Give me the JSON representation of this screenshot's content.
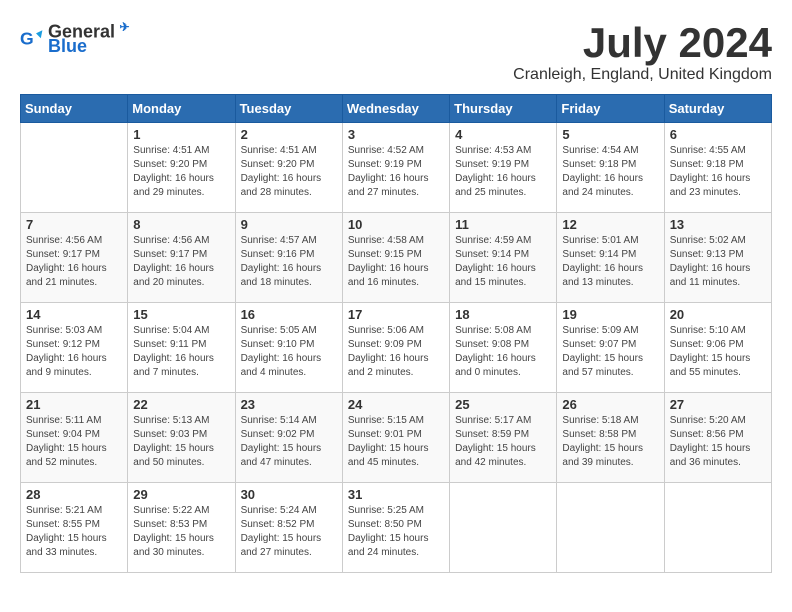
{
  "header": {
    "logo_general": "General",
    "logo_blue": "Blue",
    "month_year": "July 2024",
    "location": "Cranleigh, England, United Kingdom"
  },
  "days_of_week": [
    "Sunday",
    "Monday",
    "Tuesday",
    "Wednesday",
    "Thursday",
    "Friday",
    "Saturday"
  ],
  "weeks": [
    [
      {
        "day": "",
        "info": ""
      },
      {
        "day": "1",
        "info": "Sunrise: 4:51 AM\nSunset: 9:20 PM\nDaylight: 16 hours\nand 29 minutes."
      },
      {
        "day": "2",
        "info": "Sunrise: 4:51 AM\nSunset: 9:20 PM\nDaylight: 16 hours\nand 28 minutes."
      },
      {
        "day": "3",
        "info": "Sunrise: 4:52 AM\nSunset: 9:19 PM\nDaylight: 16 hours\nand 27 minutes."
      },
      {
        "day": "4",
        "info": "Sunrise: 4:53 AM\nSunset: 9:19 PM\nDaylight: 16 hours\nand 25 minutes."
      },
      {
        "day": "5",
        "info": "Sunrise: 4:54 AM\nSunset: 9:18 PM\nDaylight: 16 hours\nand 24 minutes."
      },
      {
        "day": "6",
        "info": "Sunrise: 4:55 AM\nSunset: 9:18 PM\nDaylight: 16 hours\nand 23 minutes."
      }
    ],
    [
      {
        "day": "7",
        "info": "Sunrise: 4:56 AM\nSunset: 9:17 PM\nDaylight: 16 hours\nand 21 minutes."
      },
      {
        "day": "8",
        "info": "Sunrise: 4:56 AM\nSunset: 9:17 PM\nDaylight: 16 hours\nand 20 minutes."
      },
      {
        "day": "9",
        "info": "Sunrise: 4:57 AM\nSunset: 9:16 PM\nDaylight: 16 hours\nand 18 minutes."
      },
      {
        "day": "10",
        "info": "Sunrise: 4:58 AM\nSunset: 9:15 PM\nDaylight: 16 hours\nand 16 minutes."
      },
      {
        "day": "11",
        "info": "Sunrise: 4:59 AM\nSunset: 9:14 PM\nDaylight: 16 hours\nand 15 minutes."
      },
      {
        "day": "12",
        "info": "Sunrise: 5:01 AM\nSunset: 9:14 PM\nDaylight: 16 hours\nand 13 minutes."
      },
      {
        "day": "13",
        "info": "Sunrise: 5:02 AM\nSunset: 9:13 PM\nDaylight: 16 hours\nand 11 minutes."
      }
    ],
    [
      {
        "day": "14",
        "info": "Sunrise: 5:03 AM\nSunset: 9:12 PM\nDaylight: 16 hours\nand 9 minutes."
      },
      {
        "day": "15",
        "info": "Sunrise: 5:04 AM\nSunset: 9:11 PM\nDaylight: 16 hours\nand 7 minutes."
      },
      {
        "day": "16",
        "info": "Sunrise: 5:05 AM\nSunset: 9:10 PM\nDaylight: 16 hours\nand 4 minutes."
      },
      {
        "day": "17",
        "info": "Sunrise: 5:06 AM\nSunset: 9:09 PM\nDaylight: 16 hours\nand 2 minutes."
      },
      {
        "day": "18",
        "info": "Sunrise: 5:08 AM\nSunset: 9:08 PM\nDaylight: 16 hours\nand 0 minutes."
      },
      {
        "day": "19",
        "info": "Sunrise: 5:09 AM\nSunset: 9:07 PM\nDaylight: 15 hours\nand 57 minutes."
      },
      {
        "day": "20",
        "info": "Sunrise: 5:10 AM\nSunset: 9:06 PM\nDaylight: 15 hours\nand 55 minutes."
      }
    ],
    [
      {
        "day": "21",
        "info": "Sunrise: 5:11 AM\nSunset: 9:04 PM\nDaylight: 15 hours\nand 52 minutes."
      },
      {
        "day": "22",
        "info": "Sunrise: 5:13 AM\nSunset: 9:03 PM\nDaylight: 15 hours\nand 50 minutes."
      },
      {
        "day": "23",
        "info": "Sunrise: 5:14 AM\nSunset: 9:02 PM\nDaylight: 15 hours\nand 47 minutes."
      },
      {
        "day": "24",
        "info": "Sunrise: 5:15 AM\nSunset: 9:01 PM\nDaylight: 15 hours\nand 45 minutes."
      },
      {
        "day": "25",
        "info": "Sunrise: 5:17 AM\nSunset: 8:59 PM\nDaylight: 15 hours\nand 42 minutes."
      },
      {
        "day": "26",
        "info": "Sunrise: 5:18 AM\nSunset: 8:58 PM\nDaylight: 15 hours\nand 39 minutes."
      },
      {
        "day": "27",
        "info": "Sunrise: 5:20 AM\nSunset: 8:56 PM\nDaylight: 15 hours\nand 36 minutes."
      }
    ],
    [
      {
        "day": "28",
        "info": "Sunrise: 5:21 AM\nSunset: 8:55 PM\nDaylight: 15 hours\nand 33 minutes."
      },
      {
        "day": "29",
        "info": "Sunrise: 5:22 AM\nSunset: 8:53 PM\nDaylight: 15 hours\nand 30 minutes."
      },
      {
        "day": "30",
        "info": "Sunrise: 5:24 AM\nSunset: 8:52 PM\nDaylight: 15 hours\nand 27 minutes."
      },
      {
        "day": "31",
        "info": "Sunrise: 5:25 AM\nSunset: 8:50 PM\nDaylight: 15 hours\nand 24 minutes."
      },
      {
        "day": "",
        "info": ""
      },
      {
        "day": "",
        "info": ""
      },
      {
        "day": "",
        "info": ""
      }
    ]
  ]
}
